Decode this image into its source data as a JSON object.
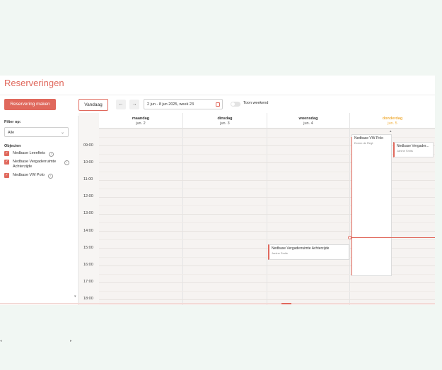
{
  "page": {
    "title": "Reserveringen"
  },
  "toolbar": {
    "new_label": "Reservering maken",
    "today_label": "Vandaag",
    "prev_icon": "←",
    "next_icon": "→",
    "date_range": "2 jun - 8 jun 2025, week 23",
    "weekend_label": "Toon weekend",
    "weekend_on": false
  },
  "sidebar": {
    "filter_label": "Filter op:",
    "filter_value": "Alle",
    "objects_label": "Objecten",
    "objects": [
      {
        "label": "Nedbase Leenfiets"
      },
      {
        "label": "Nedbase Vergaderruimte Achterzijde"
      },
      {
        "label": "Nedbase VW Polo"
      }
    ]
  },
  "calendar": {
    "days": [
      {
        "name": "maandag",
        "date": "jun. 2"
      },
      {
        "name": "dinsdag",
        "date": "jun. 3"
      },
      {
        "name": "woensdag",
        "date": "jun. 4"
      },
      {
        "name": "donderdag",
        "date": "jun. 5"
      }
    ],
    "hours": [
      "09:00",
      "10:00",
      "11:00",
      "12:00",
      "13:00",
      "14:00",
      "15:00",
      "16:00",
      "17:00",
      "18:00"
    ],
    "events": [
      {
        "title": "Nedbase Vergaderruimte Achterzijde",
        "subtitle": "Janine Smits"
      },
      {
        "title": "Nedbase VW Polo",
        "subtitle": "Ecenn de Regt"
      },
      {
        "title": "Nedbase Vergader...",
        "subtitle": "Janine Smits"
      }
    ]
  },
  "colors": {
    "accent": "#e0685c",
    "today": "#f0b040"
  }
}
